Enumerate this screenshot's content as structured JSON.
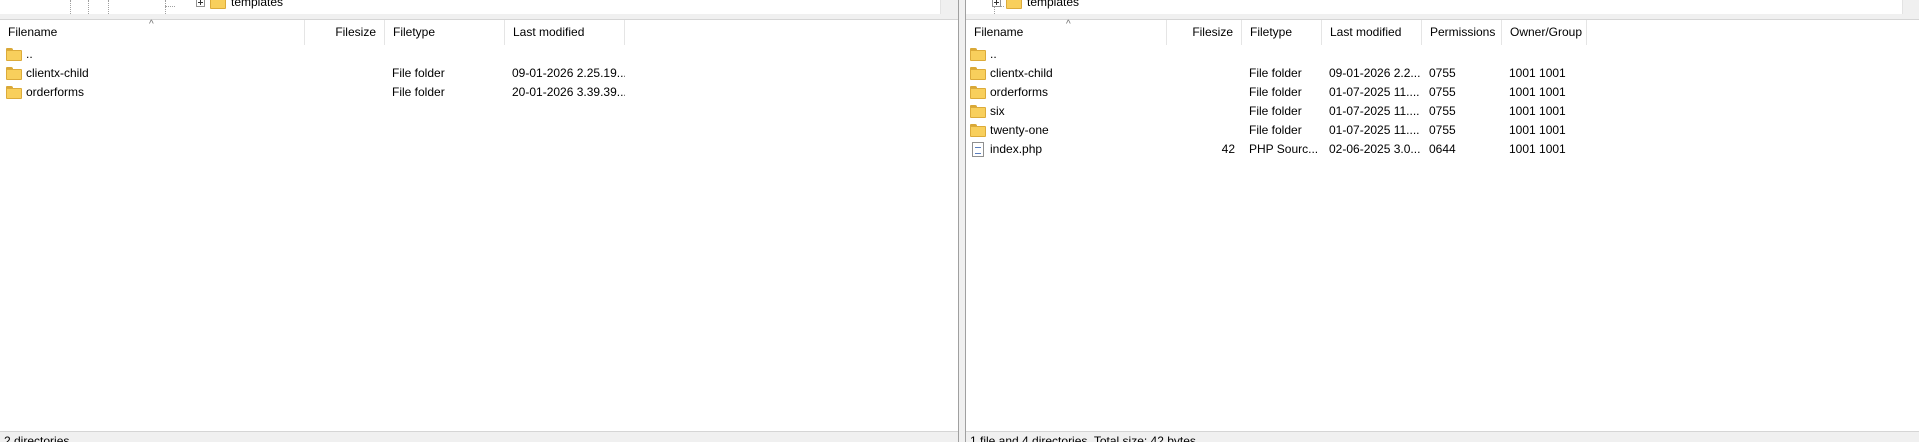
{
  "local": {
    "tree_node_label": "templates",
    "columns": {
      "filename": "Filename",
      "filesize": "Filesize",
      "filetype": "Filetype",
      "last_modified": "Last modified"
    },
    "rows": [
      {
        "name": "..",
        "size": "",
        "type": "",
        "modified": "",
        "icon": "folder-icon"
      },
      {
        "name": "clientx-child",
        "size": "",
        "type": "File folder",
        "modified": "09-01-2026 2.25.19...",
        "icon": "folder-icon"
      },
      {
        "name": "orderforms",
        "size": "",
        "type": "File folder",
        "modified": "20-01-2026 3.39.39...",
        "icon": "folder-icon"
      }
    ],
    "status": "2 directories"
  },
  "remote": {
    "tree_node_label": "templates",
    "columns": {
      "filename": "Filename",
      "filesize": "Filesize",
      "filetype": "Filetype",
      "last_modified": "Last modified",
      "permissions": "Permissions",
      "owner_group": "Owner/Group"
    },
    "rows": [
      {
        "name": "..",
        "size": "",
        "type": "",
        "modified": "",
        "permissions": "",
        "owner": "",
        "icon": "folder-icon"
      },
      {
        "name": "clientx-child",
        "size": "",
        "type": "File folder",
        "modified": "09-01-2026 2.2...",
        "permissions": "0755",
        "owner": "1001 1001",
        "icon": "folder-icon"
      },
      {
        "name": "orderforms",
        "size": "",
        "type": "File folder",
        "modified": "01-07-2025 11....",
        "permissions": "0755",
        "owner": "1001 1001",
        "icon": "folder-icon"
      },
      {
        "name": "six",
        "size": "",
        "type": "File folder",
        "modified": "01-07-2025 11....",
        "permissions": "0755",
        "owner": "1001 1001",
        "icon": "folder-icon"
      },
      {
        "name": "twenty-one",
        "size": "",
        "type": "File folder",
        "modified": "01-07-2025 11....",
        "permissions": "0755",
        "owner": "1001 1001",
        "icon": "folder-icon"
      },
      {
        "name": "index.php",
        "size": "42",
        "type": "PHP Sourc...",
        "modified": "02-06-2025 3.0...",
        "permissions": "0644",
        "owner": "1001 1001",
        "icon": "php-file-icon"
      }
    ],
    "status": "1 file and 4 directories. Total size: 42 bytes"
  },
  "icons": {
    "sort_arrow": "^"
  }
}
